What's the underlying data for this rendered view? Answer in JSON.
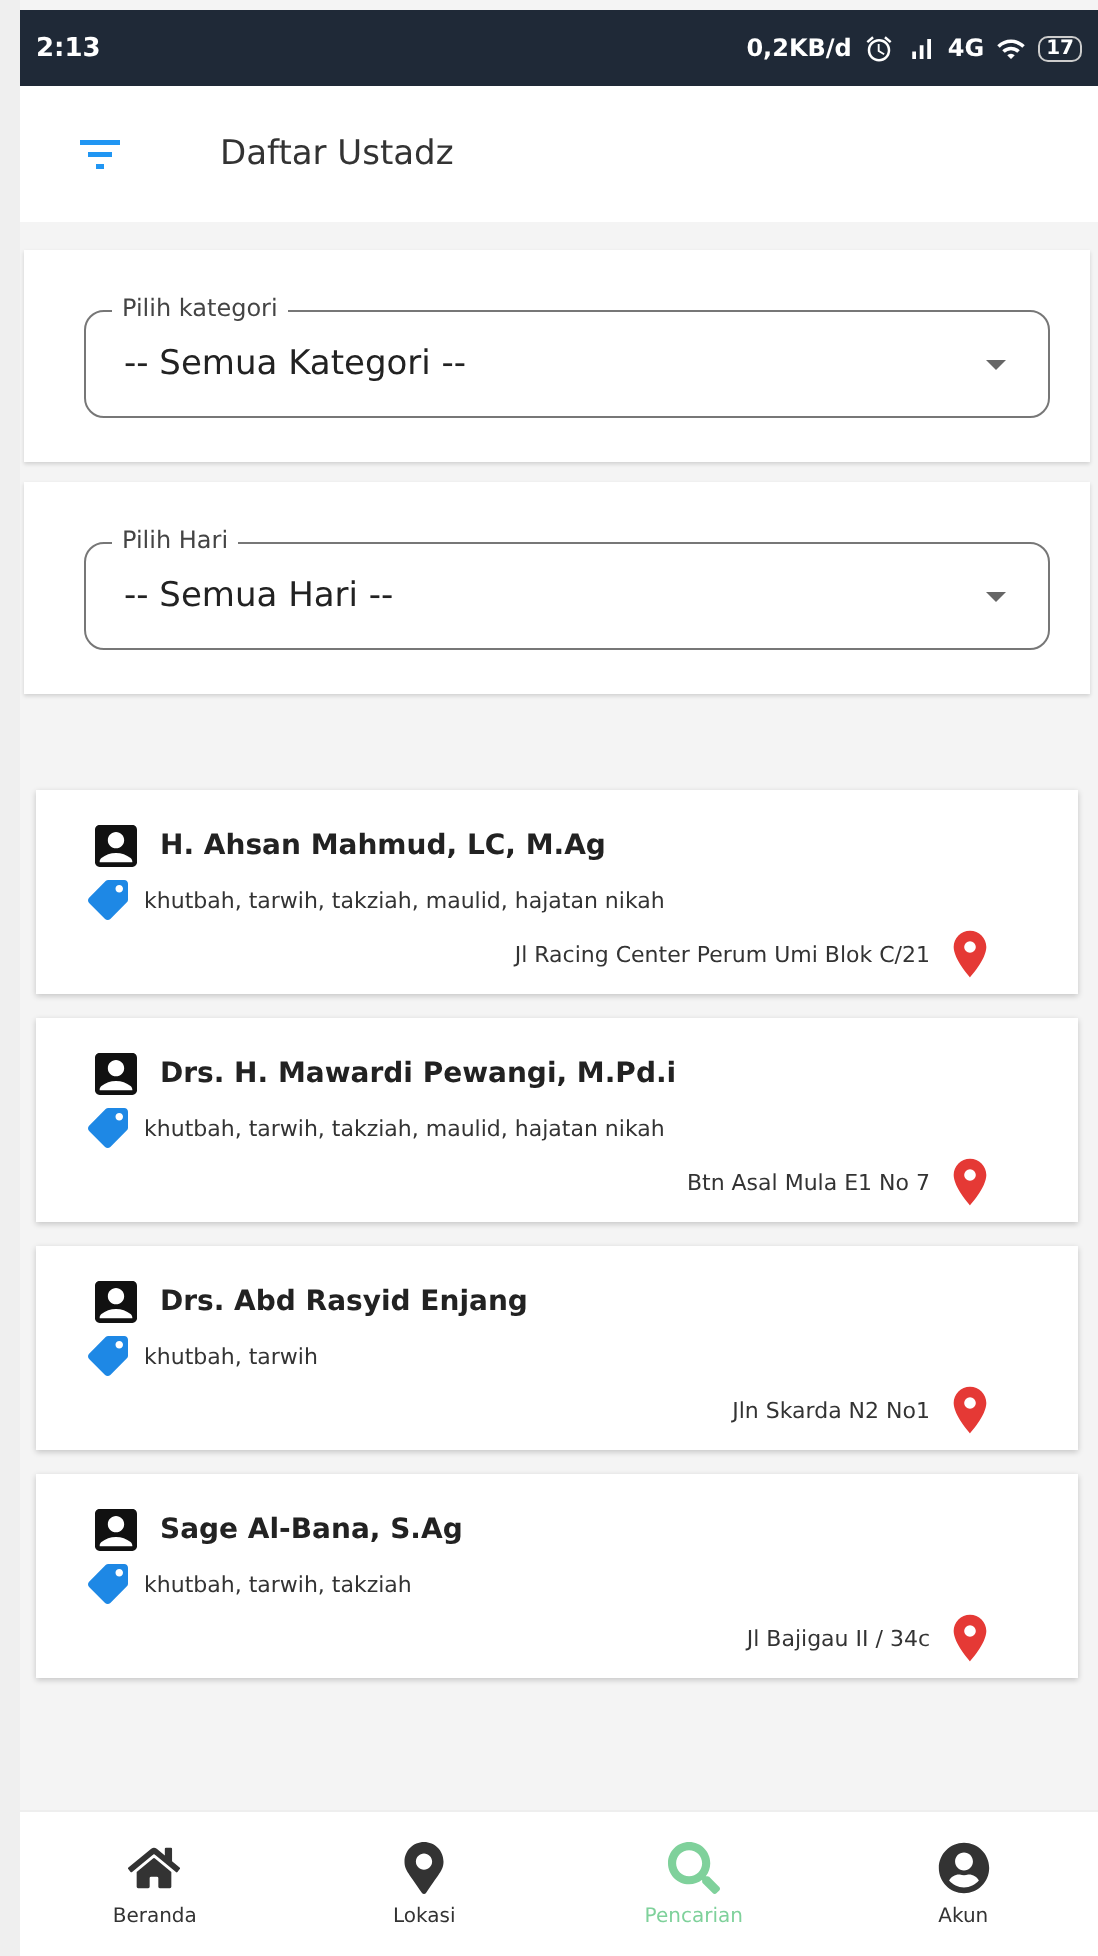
{
  "status_bar": {
    "time": "2:13",
    "net_speed": "0,2KB/d",
    "network": "4G",
    "battery": "17"
  },
  "header": {
    "title": "Daftar Ustadz"
  },
  "filters": [
    {
      "label": "Pilih kategori",
      "value": "-- Semua Kategori --"
    },
    {
      "label": "Pilih Hari",
      "value": "-- Semua Hari --"
    }
  ],
  "ustadz": [
    {
      "name": "H. Ahsan Mahmud, LC, M.Ag",
      "services": "khutbah, tarwih, takziah, maulid, hajatan nikah",
      "address": "Jl Racing Center Perum Umi Blok C/21"
    },
    {
      "name": "Drs. H. Mawardi Pewangi, M.Pd.i",
      "services": "khutbah, tarwih, takziah, maulid, hajatan nikah",
      "address": "Btn Asal Mula E1 No 7"
    },
    {
      "name": "Drs. Abd Rasyid Enjang",
      "services": "khutbah, tarwih",
      "address": "Jln Skarda N2 No1"
    },
    {
      "name": "Sage Al-Bana, S.Ag",
      "services": "khutbah, tarwih, takziah",
      "address": "Jl Bajigau II / 34c"
    }
  ],
  "bottom_nav": [
    {
      "label": "Beranda",
      "selected": false
    },
    {
      "label": "Lokasi",
      "selected": false
    },
    {
      "label": "Pencarian",
      "selected": true
    },
    {
      "label": "Akun",
      "selected": false
    }
  ]
}
